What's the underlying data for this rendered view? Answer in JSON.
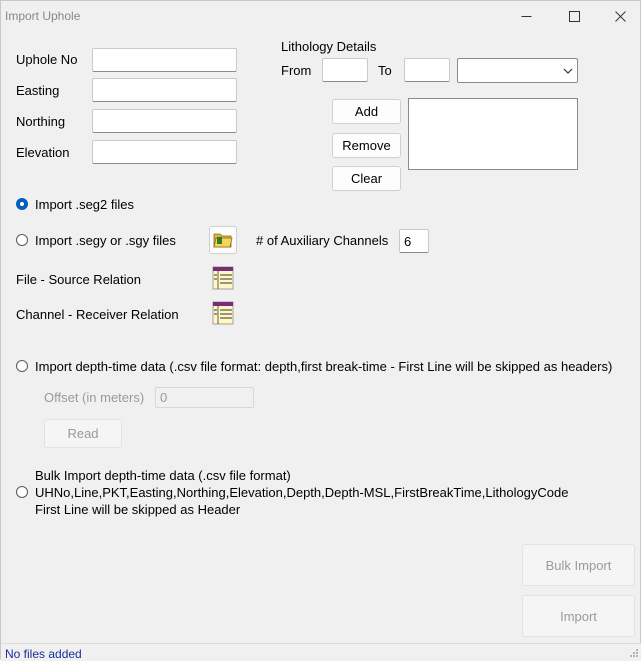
{
  "window": {
    "title": "Import Uphole"
  },
  "uphole": {
    "uphole_no_label": "Uphole No",
    "easting_label": "Easting",
    "northing_label": "Northing",
    "elevation_label": "Elevation",
    "uphole_no_value": "",
    "easting_value": "",
    "northing_value": "",
    "elevation_value": ""
  },
  "lithology": {
    "heading": "Lithology Details",
    "from_label": "From",
    "to_label": "To",
    "from_value": "",
    "to_value": "",
    "code_selected": "",
    "add_label": "Add",
    "remove_label": "Remove",
    "clear_label": "Clear"
  },
  "seg2": {
    "label": "Import .seg2 files",
    "checked": true
  },
  "segy": {
    "label": "Import .segy or .sgy files",
    "aux_label": "# of Auxiliary Channels",
    "aux_value": "6",
    "checked": false
  },
  "relations": {
    "file_source_label": "File - Source Relation",
    "channel_receiver_label": "Channel - Receiver Relation"
  },
  "depth_time": {
    "label": "Import depth-time data (.csv file format:  depth,first break-time - First Line will be skipped as headers)",
    "offset_label": "Offset (in meters)",
    "offset_value": "0",
    "read_label": "Read"
  },
  "bulk": {
    "line1": "Bulk Import depth-time data (.csv file format)",
    "line2": "UHNo,Line,PKT,Easting,Northing,Elevation,Depth,Depth-MSL,FirstBreakTime,LithologyCode",
    "line3": "First Line will be skipped as Header"
  },
  "actions": {
    "bulk_import_label": "Bulk Import",
    "import_label": "Import"
  },
  "status": {
    "text": "No files added"
  },
  "icons": {
    "folder": "folder-open-icon",
    "table1": "table-list-icon",
    "table2": "table-list-icon"
  },
  "colors": {
    "accent": "#005fb8",
    "status_text": "#1a2f9a",
    "window_bg": "#f0f0f0"
  }
}
